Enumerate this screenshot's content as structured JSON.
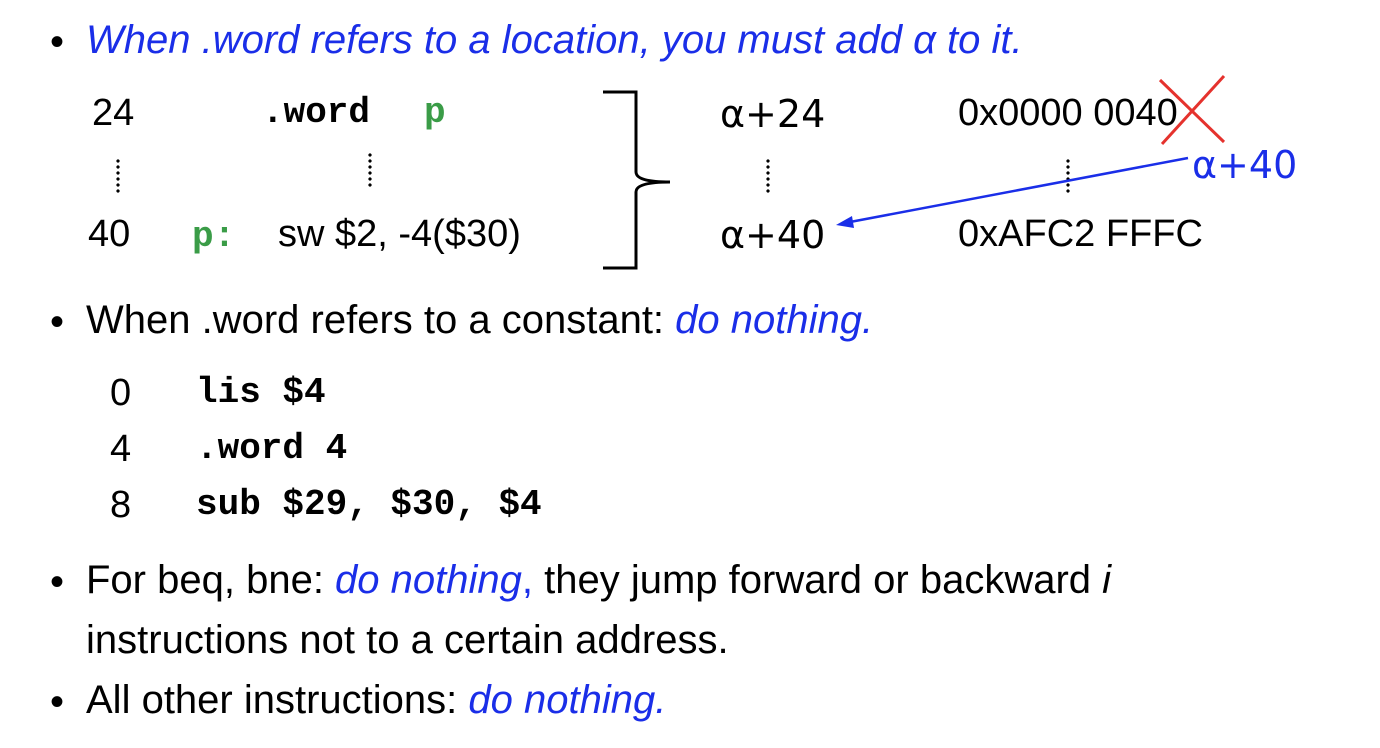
{
  "bullets": [
    {
      "symbol": "•",
      "text": "When .word refers to a location, you must add α to it."
    },
    {
      "symbol": "•",
      "text_plain": "When .word refers to a constant: ",
      "text_em": "do nothing."
    },
    {
      "symbol": "•",
      "text_plain": "For beq, bne: ",
      "text_em": "do nothing",
      "text_after": ", they jump forward or backward ",
      "text_i": "i",
      "line2": "instructions not to a certain address."
    },
    {
      "symbol": "•",
      "text_plain": "All other instructions: ",
      "text_em": "do nothing."
    }
  ],
  "location_example": {
    "left": {
      "row1": {
        "addr": "24",
        "directive": ".word",
        "operand": "p"
      },
      "row2": {
        "addr": "40",
        "label": "p:",
        "instr": "sw $2, -4($30)"
      }
    },
    "right": {
      "row1": {
        "addr": "α+24",
        "value": "0x0000 0040"
      },
      "row2": {
        "addr": "α+40",
        "value": "0xAFC2 FFFC"
      },
      "annotation": "α+40"
    }
  },
  "constant_example": [
    {
      "addr": "0",
      "code": "lis $4"
    },
    {
      "addr": "4",
      "code": ".word 4"
    },
    {
      "addr": "8",
      "code": "sub $29, $30, $4"
    }
  ],
  "colors": {
    "emphasis": "#1a2ee8",
    "label": "#3a9c47",
    "cross": "#e5322d"
  }
}
